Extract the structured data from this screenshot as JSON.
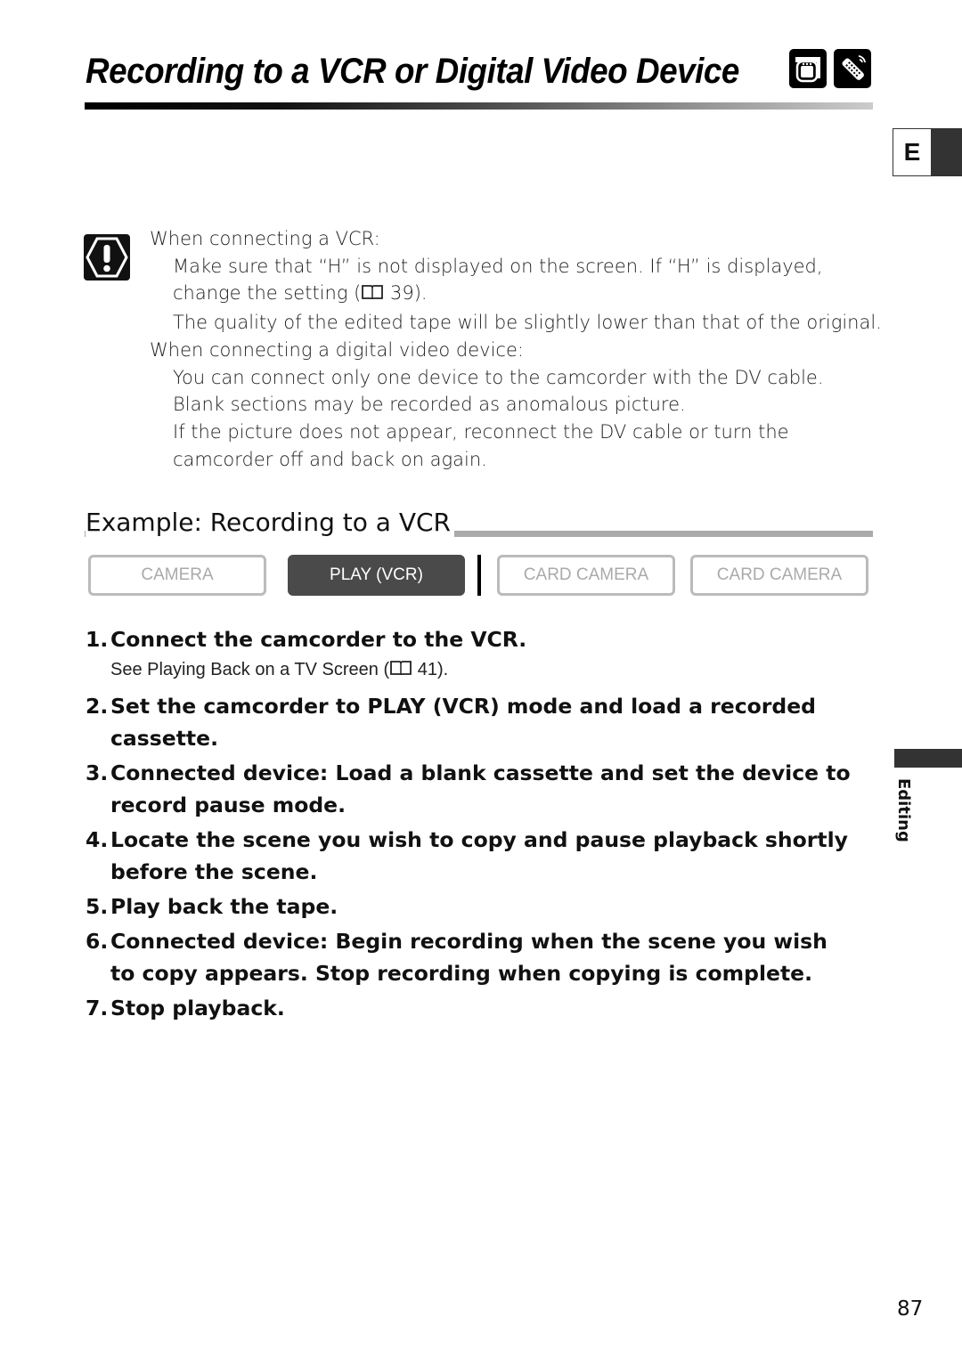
{
  "header": {
    "title": "Recording to a VCR or Digital Video Device",
    "icons": [
      "camcorder-icon",
      "remote-control-icon"
    ]
  },
  "language_tab": {
    "label": "E"
  },
  "caution": {
    "icon": "caution-icon",
    "vcr_heading": "When connecting a VCR:",
    "vcr_items": [
      {
        "text_before_ref": "Make sure that “H” is not displayed on the screen. If “H” is displayed, change the setting (",
        "ref_page": "39",
        "text_after_ref": ")."
      },
      {
        "text": "The quality of the edited tape will be slightly lower than that of the original."
      }
    ],
    "dv_heading": "When connecting a digital video device:",
    "dv_items": [
      "You can connect only one device to the camcorder with the DV cable.",
      "Blank sections may be recorded as anomalous picture.",
      "If the picture does not appear, reconnect the DV cable or turn the camcorder off and back on again."
    ]
  },
  "section": {
    "title": "Example: Recording to a VCR"
  },
  "modes": [
    {
      "label": "CAMERA",
      "active": false
    },
    {
      "label": "PLAY (VCR)",
      "active": true
    },
    {
      "label": "CARD CAMERA",
      "active": false
    },
    {
      "label": "CARD CAMERA",
      "active": false
    }
  ],
  "steps": [
    {
      "num": "1.",
      "text": "Connect the camcorder to the VCR.",
      "sub": {
        "before": "See Playing Back on a TV Screen (",
        "ref_page": "41",
        "after": ")."
      }
    },
    {
      "num": "2.",
      "text": "Set the camcorder to PLAY (VCR) mode and load a recorded cassette."
    },
    {
      "num": "3.",
      "text": "Connected device: Load a blank cassette and set the device to record pause mode."
    },
    {
      "num": "4.",
      "text": "Locate the scene you wish to copy and pause playback shortly before the scene."
    },
    {
      "num": "5.",
      "text": "Play back the tape."
    },
    {
      "num": "6.",
      "text": "Connected device: Begin recording when the scene you wish to copy appears. Stop recording when copying is complete."
    },
    {
      "num": "7.",
      "text": "Stop playback."
    }
  ],
  "side_tab": {
    "label": "Editing"
  },
  "page_number": "87"
}
